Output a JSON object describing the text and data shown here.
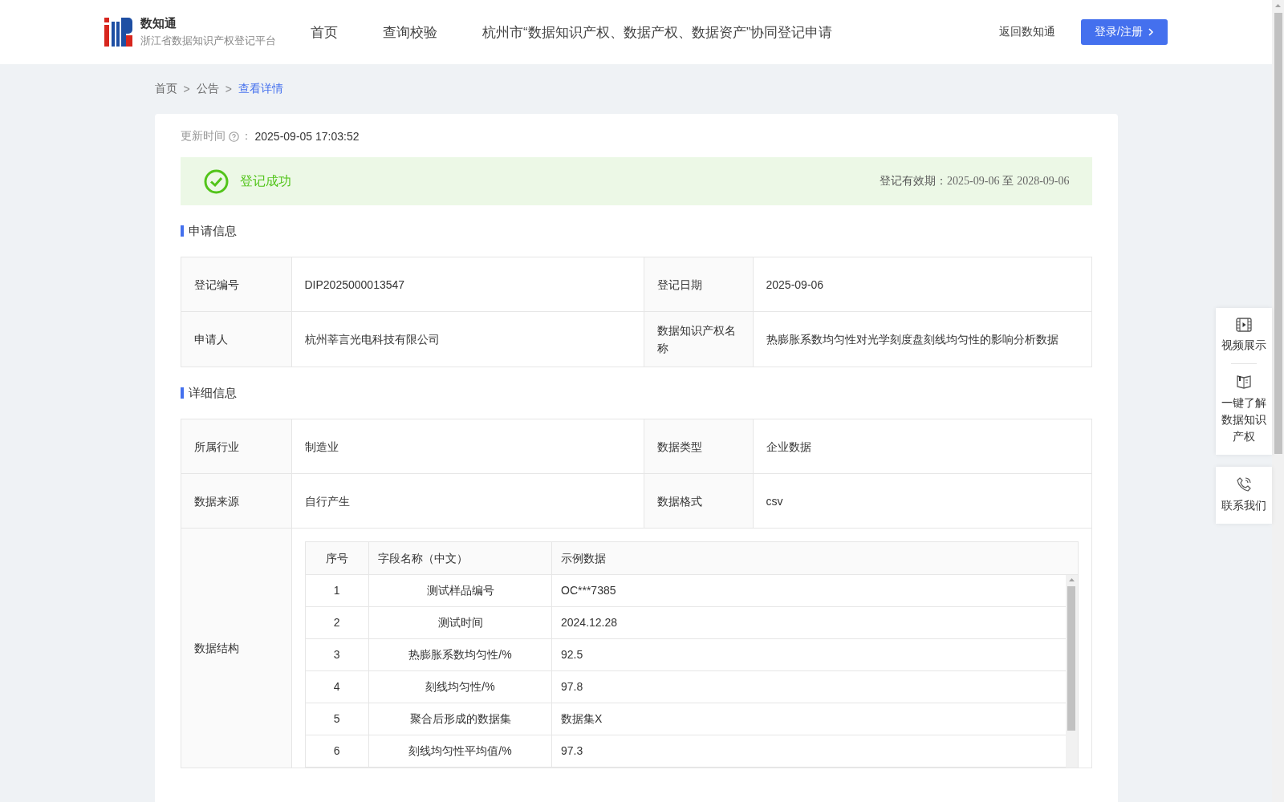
{
  "header": {
    "logo_title": "数知通",
    "logo_subtitle": "浙江省数据知识产权登记平台",
    "nav": [
      {
        "label": "首页",
        "selected": false
      },
      {
        "label": "查询校验",
        "selected": false
      },
      {
        "label": "杭州市“数据知识产权、数据产权、数据资产”协同登记申请",
        "selected": false
      }
    ],
    "back_link": "返回数知通",
    "login_button": "登录/注册"
  },
  "breadcrumb": [
    {
      "label": "首页",
      "current": false
    },
    {
      "label": "公告",
      "current": false
    },
    {
      "label": "查看详情",
      "current": true
    }
  ],
  "breadcrumb_separator": ">",
  "update": {
    "label": "更新时间",
    "colon": "：",
    "value": "2025-09-05 17:03:52"
  },
  "status": {
    "text": "登记成功",
    "validity_label": "登记有效期：",
    "validity_start": "2025-09-06",
    "validity_to": "至",
    "validity_end": "2028-09-06"
  },
  "sections": [
    {
      "title": "申请信息",
      "rows": [
        [
          {
            "label": "登记编号",
            "value": "DIP2025000013547"
          },
          {
            "label": "登记日期",
            "value": "2025-09-06"
          }
        ],
        [
          {
            "label": "申请人",
            "value": "杭州莘言光电科技有限公司"
          },
          {
            "label": "数据知识产权名称",
            "value": "热膨胀系数均匀性对光学刻度盘刻线均匀性的影响分析数据"
          }
        ]
      ]
    },
    {
      "title": "详细信息",
      "rows": [
        [
          {
            "label": "所属行业",
            "value": "制造业"
          },
          {
            "label": "数据类型",
            "value": "企业数据"
          }
        ],
        [
          {
            "label": "数据来源",
            "value": "自行产生"
          },
          {
            "label": "数据格式",
            "value": "csv"
          }
        ]
      ],
      "structure": {
        "label": "数据结构",
        "columns": [
          "序号",
          "字段名称（中文）",
          "示例数据"
        ],
        "rows": [
          [
            "1",
            "测试样品编号",
            "OC***7385"
          ],
          [
            "2",
            "测试时间",
            "2024.12.28"
          ],
          [
            "3",
            "热膨胀系数均匀性/%",
            "92.5"
          ],
          [
            "4",
            "刻线均匀性/%",
            "97.8"
          ],
          [
            "5",
            "聚合后形成的数据集",
            "数据集X"
          ],
          [
            "6",
            "刻线均匀性平均值/%",
            "97.3"
          ]
        ]
      }
    }
  ],
  "side_panel": [
    {
      "kind": "video",
      "label": "视频展示"
    },
    {
      "kind": "book",
      "label": "一键了解数据知识产权"
    },
    {
      "kind": "phone",
      "label": "联系我们"
    }
  ]
}
